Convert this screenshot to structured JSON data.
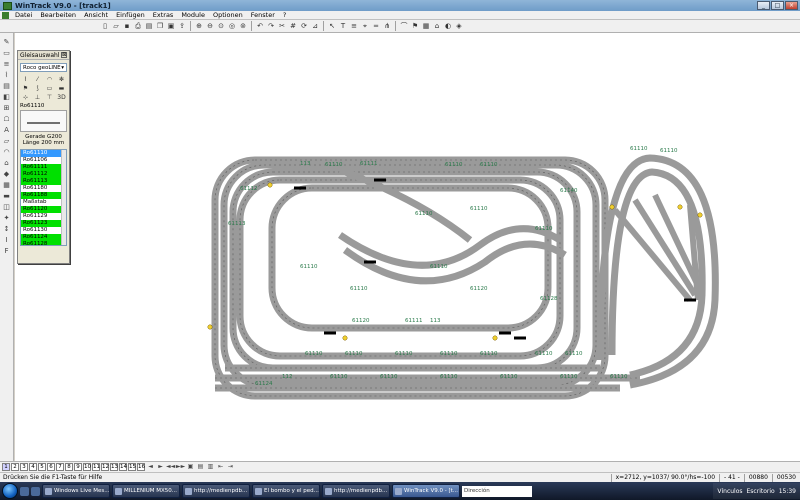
{
  "window": {
    "title": "WinTrack  V9.0 - [track1]",
    "min": "_",
    "max": "□",
    "close": "×"
  },
  "menu": [
    "Datei",
    "Bearbeiten",
    "Ansicht",
    "Einfügen",
    "Extras",
    "Module",
    "Optionen",
    "Fenster",
    "?"
  ],
  "toolbar_icons": [
    "new-icon",
    "open-icon",
    "save-icon",
    "print-icon",
    "preview-icon",
    "copy-icon",
    "paste-icon",
    "export-icon",
    "zoom-in-icon",
    "zoom-out-icon",
    "zoom-fit-icon",
    "zoom-window-icon",
    "zoom-all-icon",
    "undo-icon",
    "redo-icon",
    "cut-icon",
    "grid-icon",
    "rotate-icon",
    "measure-icon",
    "select-icon",
    "text-icon",
    "layer-icon",
    "snap-icon",
    "track-icon",
    "switch-icon",
    "bridge-icon",
    "signal-icon",
    "block-icon",
    "station-icon",
    "color-icon",
    "3d-icon"
  ],
  "left_tools": [
    "✎",
    "▭",
    "≡",
    "⌇",
    "▤",
    "◧",
    "⊞",
    "☖",
    "A",
    "▱",
    "◠",
    "⌂",
    "◆",
    "▦",
    "▬",
    "◫",
    "✦",
    "↕",
    "I",
    "F"
  ],
  "panel": {
    "title": "Gleisauswahl",
    "close": "⊠",
    "manufacturer": "Roco geoLINE",
    "icon_row": [
      "⌇",
      "⁄",
      "◠",
      "✻",
      "⚑",
      "⟆",
      "▭",
      "▬",
      "⊹",
      "⊥",
      "⊤",
      "3D"
    ],
    "selected_part": "Ro61110",
    "desc_line1": "Gerade G200",
    "desc_line2": "Länge 200 mm",
    "list": [
      {
        "label": "Ro61110",
        "style": "sel"
      },
      {
        "label": "Ro61106",
        "style": "plain"
      },
      {
        "label": "Ro61111",
        "style": "green"
      },
      {
        "label": "Ro61112",
        "style": "green"
      },
      {
        "label": "Ro61113",
        "style": "green"
      },
      {
        "label": "Ro61180",
        "style": "plain"
      },
      {
        "label": "Ro61188",
        "style": "green"
      },
      {
        "label": "Maßstab",
        "style": "plain"
      },
      {
        "label": "Ro61120",
        "style": "green"
      },
      {
        "label": "Ro61129",
        "style": "plain"
      },
      {
        "label": "Ro61123",
        "style": "green"
      },
      {
        "label": "Ro61130",
        "style": "plain"
      },
      {
        "label": "Ro61124",
        "style": "green"
      },
      {
        "label": "Ro61128",
        "style": "green"
      },
      {
        "label": "Ro61140",
        "style": "green"
      }
    ]
  },
  "track_labels": {
    "straight": "61110",
    "curve_a": "61111",
    "curve_b": "61112",
    "curve_c": "61113",
    "curve_d": "61120",
    "switch_a": "61140",
    "switch_b": "61128",
    "short": "113",
    "medium": "112",
    "long": "61124"
  },
  "layers": [
    "1",
    "2",
    "3",
    "4",
    "5",
    "6",
    "7",
    "8",
    "9",
    "10",
    "11",
    "12",
    "13",
    "14",
    "15",
    "16"
  ],
  "status": {
    "help": "Drücken Sie die  F1-Taste für Hilfe",
    "coords": "x=2712, y=1037/ 90.0°/hs=-100",
    "page": "- 41 -",
    "code1": "00880",
    "code2": "00530"
  },
  "taskbar": {
    "tasks": [
      {
        "label": "Windows Live Mes...",
        "active": false
      },
      {
        "label": "MILLENIUM MX50...",
        "active": false
      },
      {
        "label": "http://medienpdb...",
        "active": false
      },
      {
        "label": "El bombo y el ped...",
        "active": false
      },
      {
        "label": "http://medienpdb...",
        "active": false
      },
      {
        "label": "WinTrack  V9.0 - [t...",
        "active": true
      }
    ],
    "address_label": "Dirección",
    "links": "Vínculos",
    "desktop": "Escritorio",
    "clock": "15:39"
  }
}
